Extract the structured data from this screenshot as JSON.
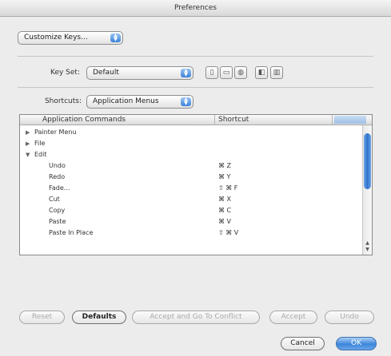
{
  "window": {
    "title": "Preferences"
  },
  "panel_select": {
    "value": "Customize Keys..."
  },
  "key_set": {
    "label": "Key Set:",
    "value": "Default"
  },
  "key_set_icons": [
    "new-set-icon",
    "duplicate-set-icon",
    "save-set-icon",
    "summarize-icon",
    "delete-set-icon"
  ],
  "shortcuts": {
    "label": "Shortcuts:",
    "value": "Application Menus"
  },
  "table": {
    "col_command": "Application Commands",
    "col_shortcut": "Shortcut",
    "rows": [
      {
        "indent": 0,
        "expand": "collapsed",
        "command": "Painter Menu",
        "shortcut": ""
      },
      {
        "indent": 0,
        "expand": "collapsed",
        "command": "File",
        "shortcut": ""
      },
      {
        "indent": 0,
        "expand": "expanded",
        "command": "Edit",
        "shortcut": ""
      },
      {
        "indent": 1,
        "expand": "",
        "command": "Undo",
        "shortcut": "⌘ Z"
      },
      {
        "indent": 1,
        "expand": "",
        "command": "Redo",
        "shortcut": "⌘ Y"
      },
      {
        "indent": 1,
        "expand": "",
        "command": "Fade...",
        "shortcut": "⇧ ⌘ F"
      },
      {
        "indent": 1,
        "expand": "",
        "command": "Cut",
        "shortcut": "⌘ X"
      },
      {
        "indent": 1,
        "expand": "",
        "command": "Copy",
        "shortcut": "⌘ C"
      },
      {
        "indent": 1,
        "expand": "",
        "command": "Paste",
        "shortcut": "⌘ V"
      },
      {
        "indent": 1,
        "expand": "",
        "command": "Paste In Place",
        "shortcut": "⇧ ⌘ V"
      }
    ]
  },
  "buttons": {
    "reset": "Reset",
    "defaults": "Defaults",
    "accept_goto": "Accept and Go To Conflict",
    "accept": "Accept",
    "undo": "Undo",
    "cancel": "Cancel",
    "ok": "OK"
  }
}
